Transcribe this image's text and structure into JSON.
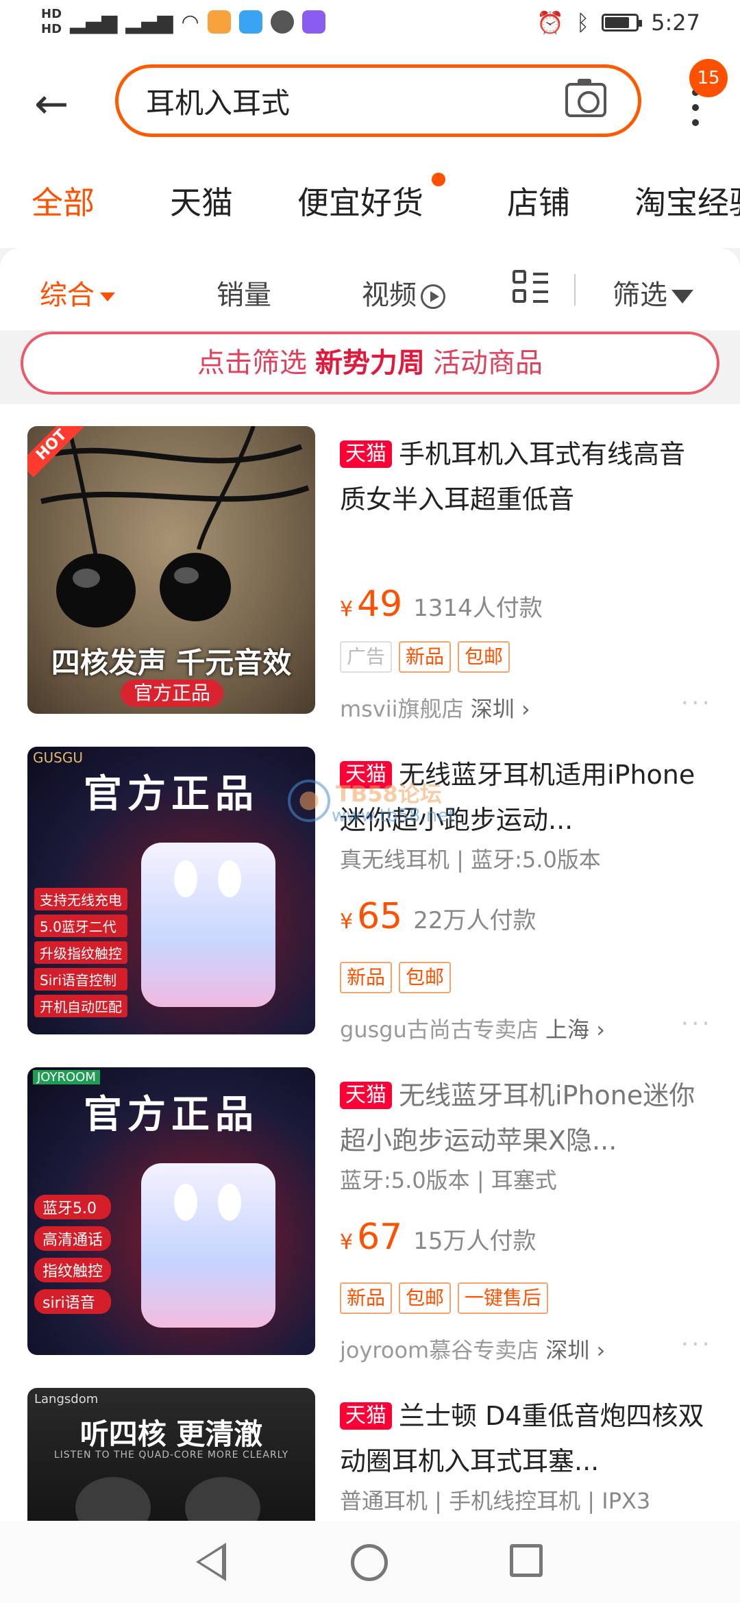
{
  "status_bar": {
    "network_1": "4G",
    "network_2": "4G",
    "time": "5:27",
    "battery_level": 0.72
  },
  "header": {
    "search_value": "耳机入耳式",
    "notification_count": "15"
  },
  "tabs": [
    {
      "label": "全部",
      "active": true
    },
    {
      "label": "天猫",
      "active": false
    },
    {
      "label": "便宜好货",
      "active": false,
      "dot": true
    },
    {
      "label": "店铺",
      "active": false
    },
    {
      "label": "淘宝经验",
      "active": false
    }
  ],
  "sort_bar": {
    "comprehensive": "综合",
    "sales": "销量",
    "video": "视频",
    "filter": "筛选"
  },
  "promo": {
    "prefix": "点击筛选",
    "highlight": "新势力周",
    "suffix": "活动商品"
  },
  "products": [
    {
      "tmall_badge": "天猫",
      "title": "手机耳机入耳式有线高音质女半入耳超重低音",
      "specs": "",
      "currency": "¥",
      "price": "49",
      "sold": "1314人付款",
      "tags": [
        "广告",
        "新品",
        "包邮"
      ],
      "shop": "msvii旗舰店",
      "city": "深圳 ›",
      "image": {
        "hot_label": "HOT",
        "caption": "四核发声 千元音效",
        "subcaption": "官方正品"
      }
    },
    {
      "tmall_badge": "天猫",
      "title": "无线蓝牙耳机适用iPhone迷你超小跑步运动...",
      "specs": "真无线耳机 | 蓝牙:5.0版本",
      "currency": "¥",
      "price": "65",
      "sold": "22万人付款",
      "tags": [
        "新品",
        "包邮"
      ],
      "shop": "gusgu古尚古专卖店",
      "city": "上海 ›",
      "image": {
        "brand": "GUSGU",
        "headline": "官方正品",
        "features": [
          "支持无线充电",
          "5.0蓝牙二代",
          "升级指纹触控",
          "Siri语音控制",
          "开机自动匹配"
        ]
      }
    },
    {
      "tmall_badge": "天猫",
      "title": "无线蓝牙耳机iPhone迷你超小跑步运动苹果X隐...",
      "specs": "蓝牙:5.0版本 | 耳塞式",
      "currency": "¥",
      "price": "67",
      "sold": "15万人付款",
      "tags": [
        "新品",
        "包邮",
        "一键售后"
      ],
      "shop": "joyroom慕谷专卖店",
      "city": "深圳 ›",
      "image": {
        "brand": "JOYROOM",
        "headline": "官方正品",
        "features": [
          "蓝牙5.0",
          "高清通话",
          "指纹触控",
          "siri语音"
        ]
      }
    },
    {
      "tmall_badge": "天猫",
      "title": "兰士顿 D4重低音炮四核双动圈耳机入耳式耳塞...",
      "specs": "普通耳机 | 手机线控耳机 | IPX3",
      "image": {
        "brand": "Langsdom",
        "headline": "听四核 更清澈",
        "tagline": "LISTEN TO THE QUAD-CORE MORE CLEARLY"
      }
    }
  ],
  "watermark": {
    "title": "TB58论坛",
    "url": "www.tb58.net"
  },
  "colors": {
    "accent": "#ff5000",
    "tmall": "#ff0036",
    "promo": "#e0405a"
  }
}
